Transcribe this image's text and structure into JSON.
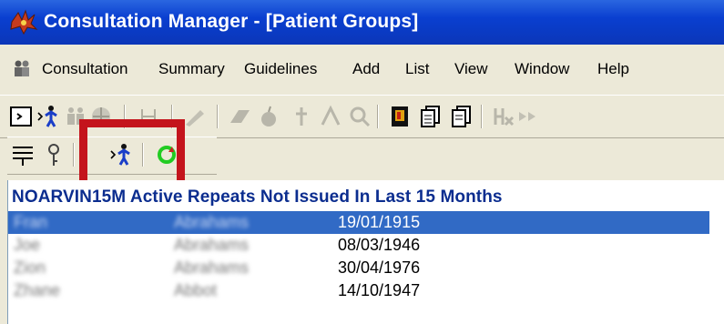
{
  "window": {
    "title": "Consultation Manager - [Patient Groups]"
  },
  "menu": {
    "items": [
      "Consultation",
      "Summary",
      "Guidelines",
      "Add",
      "List",
      "View",
      "Window",
      "Help"
    ]
  },
  "toolbar1": {
    "icons": [
      "open-consultation-icon",
      "next-patient-icon",
      "group-icon",
      "globe-icon",
      "filter-icon",
      "pen-icon",
      "eraser-icon",
      "apple-icon",
      "medical-icon",
      "figure-icon",
      "search-doc-icon",
      "book-icon",
      "copy-icon",
      "copy2-icon",
      "hx-icon"
    ]
  },
  "toolbar2": {
    "icons": [
      "list-icon",
      "key-icon",
      "next-patient-icon",
      "refresh-icon"
    ]
  },
  "list": {
    "header": "NOARVIN15M Active Repeats Not Issued In Last 15 Months",
    "rows": [
      {
        "first": "Fran",
        "surname": "Abrahams",
        "dob": "19/01/1915",
        "selected": true
      },
      {
        "first": "Joe",
        "surname": "Abrahams",
        "dob": "08/03/1946",
        "selected": false
      },
      {
        "first": "Zion",
        "surname": "Abrahams",
        "dob": "30/04/1976",
        "selected": false
      },
      {
        "first": "Zhane",
        "surname": "Abbot",
        "dob": "14/10/1947",
        "selected": false
      }
    ]
  },
  "colors": {
    "highlight": "#c4141c",
    "selection": "#316ac5",
    "titlebar": "#0b3fd0"
  }
}
